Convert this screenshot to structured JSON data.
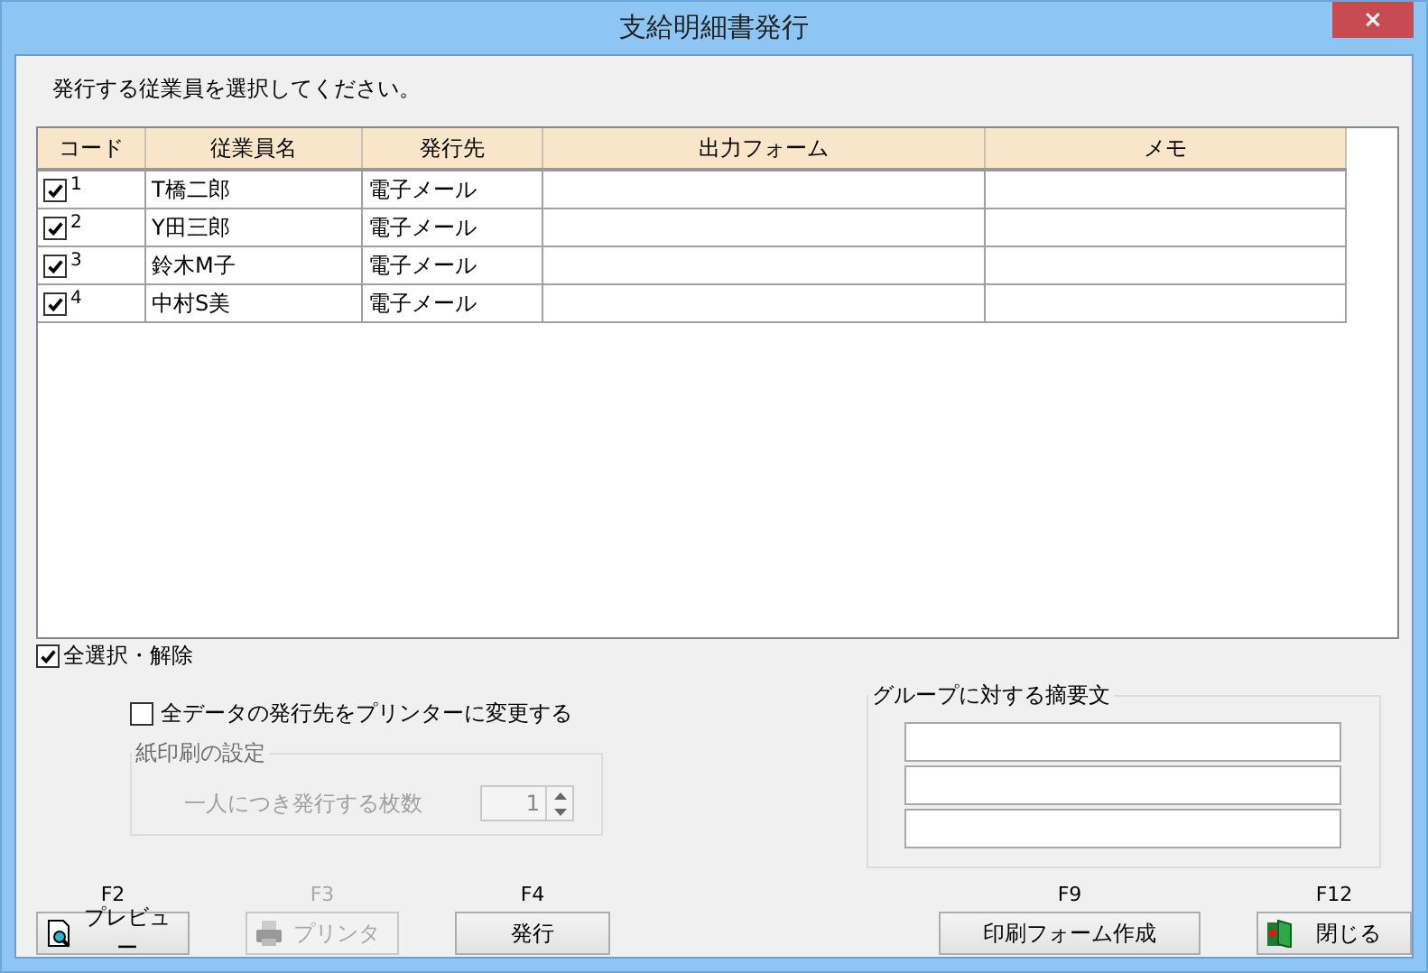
{
  "window": {
    "title": "支給明細書発行",
    "close": "×"
  },
  "instruction": "発行する従業員を選択してください。",
  "table": {
    "columns": [
      "コード",
      "従業員名",
      "発行先",
      "出力フォーム",
      "メモ"
    ],
    "rows": [
      {
        "checked": true,
        "code": "1",
        "name": "T橋二郎",
        "destination": "電子メール"
      },
      {
        "checked": true,
        "code": "2",
        "name": "Y田三郎",
        "destination": "電子メール"
      },
      {
        "checked": true,
        "code": "3",
        "name": "鈴木M子",
        "destination": "電子メール"
      },
      {
        "checked": true,
        "code": "4",
        "name": "中村S美",
        "destination": "電子メール"
      }
    ]
  },
  "select_all": {
    "label": "全選択・解除",
    "checked": true
  },
  "change_to_printer": {
    "label": "全データの発行先をプリンターに変更する",
    "checked": false
  },
  "paper_print": {
    "title": "紙印刷の設定",
    "disabled": true,
    "copies_label": "一人につき発行する枚数",
    "copies_value": "1"
  },
  "summary": {
    "title": "グループに対する摘要文"
  },
  "buttons": [
    {
      "key": "F2",
      "label": "プレビュー",
      "kind": "preview",
      "disabled": false
    },
    {
      "key": "F3",
      "label": "プリンタ",
      "kind": "printer",
      "disabled": true
    },
    {
      "key": "F4",
      "label": "発行",
      "kind": "plain",
      "disabled": false
    },
    {
      "key": "F9",
      "label": "印刷フォーム作成",
      "kind": "plain",
      "disabled": false
    },
    {
      "key": "F12",
      "label": "閉じる",
      "kind": "door",
      "disabled": false
    }
  ]
}
